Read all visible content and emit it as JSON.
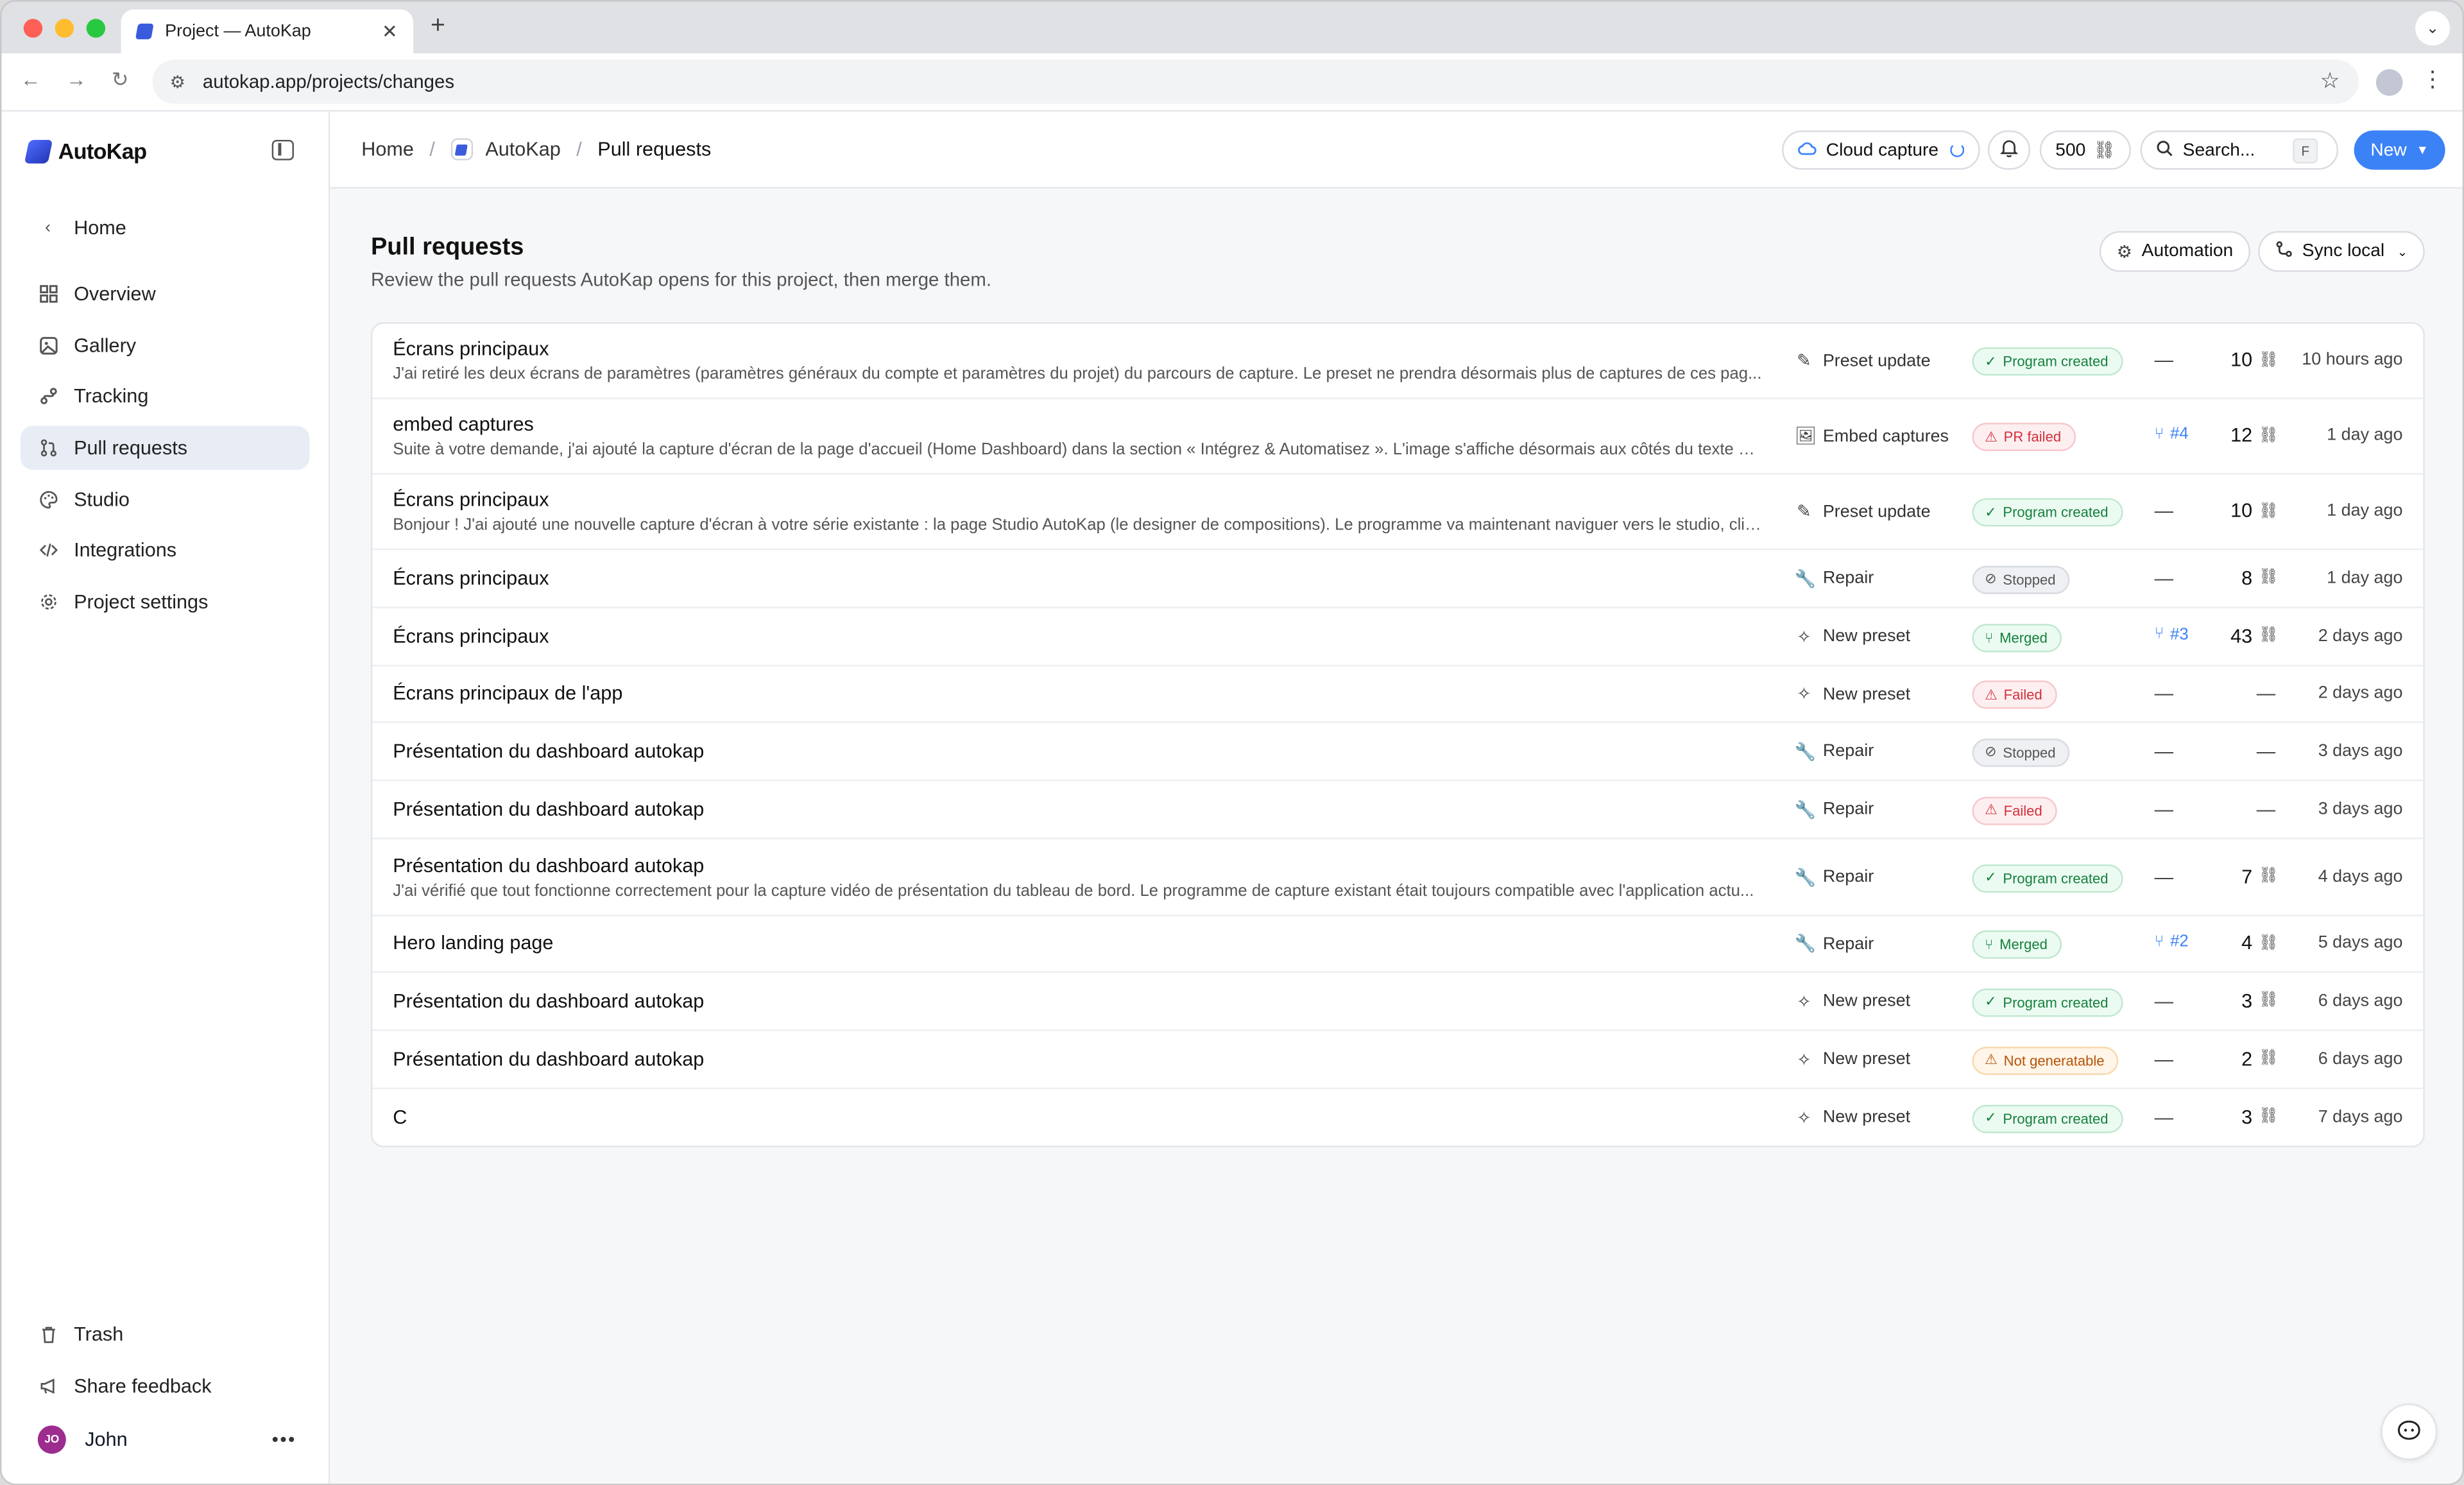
{
  "browser": {
    "tab_title": "Project — AutoKap",
    "url": "autokap.app/projects/changes"
  },
  "sidebar": {
    "brand": "AutoKap",
    "back_label": "Home",
    "items": [
      {
        "label": "Overview",
        "icon": "grid-icon"
      },
      {
        "label": "Gallery",
        "icon": "gallery-icon"
      },
      {
        "label": "Tracking",
        "icon": "tracking-icon"
      },
      {
        "label": "Pull requests",
        "icon": "pull-request-icon"
      },
      {
        "label": "Studio",
        "icon": "palette-icon"
      },
      {
        "label": "Integrations",
        "icon": "code-icon"
      },
      {
        "label": "Project settings",
        "icon": "gear-icon"
      }
    ],
    "active": "Pull requests",
    "trash_label": "Trash",
    "feedback_label": "Share feedback",
    "user": {
      "initials": "JO",
      "name": "John"
    }
  },
  "topbar": {
    "breadcrumb": [
      "Home",
      "AutoKap",
      "Pull requests"
    ],
    "cloud_capture": "Cloud capture",
    "credits": "500",
    "search_placeholder": "Search...",
    "search_shortcut": "F",
    "new_label": "New"
  },
  "page": {
    "title": "Pull requests",
    "subtitle": "Review the pull requests AutoKap opens for this project, then merge them.",
    "automation_label": "Automation",
    "sync_label": "Sync local"
  },
  "rows": [
    {
      "title": "Écrans principaux",
      "desc": "J'ai retiré les deux écrans de paramètres (paramètres généraux du compte et paramètres du projet) du parcours de capture. Le preset ne prendra désormais plus de captures de ces pag...",
      "type": "Preset update",
      "status": "Program created",
      "pr": "",
      "count": "10",
      "time": "10 hours ago"
    },
    {
      "title": "embed captures",
      "desc": "Suite à votre demande, j'ai ajouté la capture d'écran de la page d'accueil (Home Dashboard) dans la section « Intégrez & Automatisez ». L'image s'affiche désormais aux côtés du texte ex...",
      "type": "Embed captures",
      "status": "PR failed",
      "pr": "#4",
      "count": "12",
      "time": "1 day ago"
    },
    {
      "title": "Écrans principaux",
      "desc": "Bonjour ! J'ai ajouté une nouvelle capture d'écran à votre série existante : la page Studio AutoKap (le designer de compositions). Le programme va maintenant naviguer vers le studio, cliq...",
      "type": "Preset update",
      "status": "Program created",
      "pr": "",
      "count": "10",
      "time": "1 day ago"
    },
    {
      "title": "Écrans principaux",
      "desc": "",
      "type": "Repair",
      "status": "Stopped",
      "pr": "",
      "count": "8",
      "time": "1 day ago"
    },
    {
      "title": "Écrans principaux",
      "desc": "",
      "type": "New preset",
      "status": "Merged",
      "pr": "#3",
      "count": "43",
      "time": "2 days ago"
    },
    {
      "title": "Écrans principaux de l'app",
      "desc": "",
      "type": "New preset",
      "status": "Failed",
      "pr": "",
      "count": "",
      "time": "2 days ago"
    },
    {
      "title": "Présentation du dashboard autokap",
      "desc": "",
      "type": "Repair",
      "status": "Stopped",
      "pr": "",
      "count": "",
      "time": "3 days ago"
    },
    {
      "title": "Présentation du dashboard autokap",
      "desc": "",
      "type": "Repair",
      "status": "Failed",
      "pr": "",
      "count": "",
      "time": "3 days ago"
    },
    {
      "title": "Présentation du dashboard autokap",
      "desc": "J'ai vérifié que tout fonctionne correctement pour la capture vidéo de présentation du tableau de bord. Le programme de capture existant était toujours compatible avec l'application actu...",
      "type": "Repair",
      "status": "Program created",
      "pr": "",
      "count": "7",
      "time": "4 days ago"
    },
    {
      "title": "Hero landing page",
      "desc": "",
      "type": "Repair",
      "status": "Merged",
      "pr": "#2",
      "count": "4",
      "time": "5 days ago"
    },
    {
      "title": "Présentation du dashboard autokap",
      "desc": "",
      "type": "New preset",
      "status": "Program created",
      "pr": "",
      "count": "3",
      "time": "6 days ago"
    },
    {
      "title": "Présentation du dashboard autokap",
      "desc": "",
      "type": "New preset",
      "status": "Not generatable",
      "pr": "",
      "count": "2",
      "time": "6 days ago"
    },
    {
      "title": "C",
      "desc": "",
      "type": "New preset",
      "status": "Program created",
      "pr": "",
      "count": "3",
      "time": "7 days ago"
    }
  ],
  "empty_placeholder": "—",
  "status_colors": {
    "Program created": "#15803d",
    "PR failed": "#d32f3a",
    "Failed": "#d32f3a",
    "Stopped": "#555555",
    "Merged": "#15803d",
    "Not generatable": "#b45309"
  },
  "accent": "#3b82f6"
}
